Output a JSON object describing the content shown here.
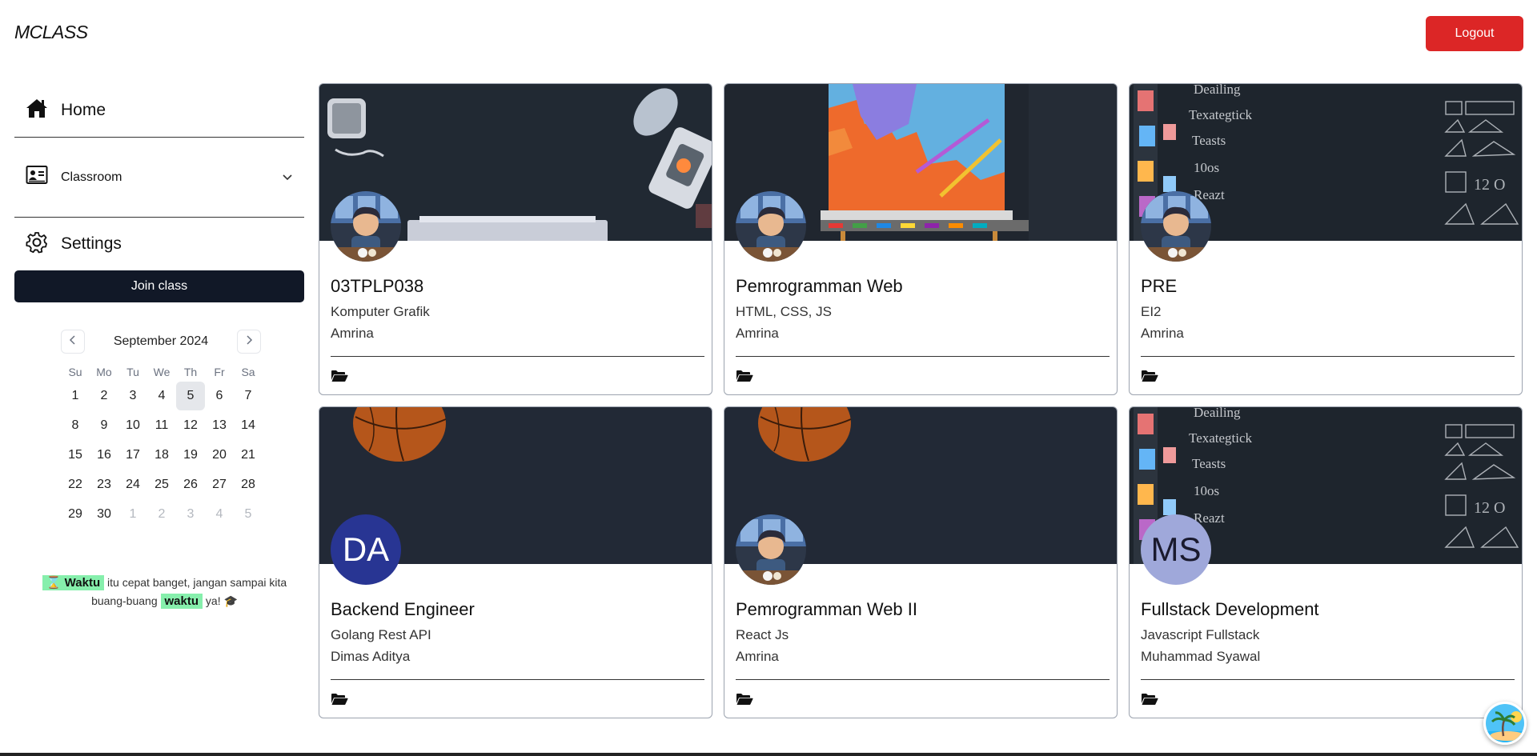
{
  "header": {
    "brand": "MCLASS",
    "logout_label": "Logout"
  },
  "sidebar": {
    "home_label": "Home",
    "classroom_label": "Classroom",
    "settings_label": "Settings",
    "join_label": "Join class"
  },
  "calendar": {
    "month_label": "September 2024",
    "weekdays": [
      "Su",
      "Mo",
      "Tu",
      "We",
      "Th",
      "Fr",
      "Sa"
    ],
    "weeks": [
      [
        "1",
        "2",
        "3",
        "4",
        "5",
        "6",
        "7"
      ],
      [
        "8",
        "9",
        "10",
        "11",
        "12",
        "13",
        "14"
      ],
      [
        "15",
        "16",
        "17",
        "18",
        "19",
        "20",
        "21"
      ],
      [
        "22",
        "23",
        "24",
        "25",
        "26",
        "27",
        "28"
      ],
      [
        "29",
        "30",
        "1",
        "2",
        "3",
        "4",
        "5"
      ]
    ],
    "today": "5"
  },
  "quote": {
    "word1": "⌛ Waktu",
    "text1": " itu cepat banget, jangan sampai kita buang-buang ",
    "word2": "waktu",
    "text2": " ya! 🎓"
  },
  "classes": [
    {
      "title": "03TPLP038",
      "subject": "Komputer Grafik",
      "teacher": "Amrina",
      "avatar_type": "photo",
      "banner": "desk"
    },
    {
      "title": "Pemrogramman Web",
      "subject": "HTML, CSS, JS",
      "teacher": "Amrina",
      "avatar_type": "photo",
      "banner": "easel"
    },
    {
      "title": "PRE",
      "subject": "EI2",
      "teacher": "Amrina",
      "avatar_type": "photo",
      "banner": "chalk"
    },
    {
      "title": "Backend Engineer",
      "subject": "Golang Rest API",
      "teacher": "Dimas Aditya",
      "avatar_type": "initials",
      "initials": "DA",
      "avatar_color": "#283593",
      "initials_color": "#ffffff",
      "banner": "ball"
    },
    {
      "title": "Pemrogramman Web II",
      "subject": "React Js",
      "teacher": "Amrina",
      "avatar_type": "photo",
      "banner": "ball"
    },
    {
      "title": "Fullstack Development",
      "subject": "Javascript Fullstack",
      "teacher": "Muhammad Syawal",
      "avatar_type": "initials",
      "initials": "MS",
      "avatar_color": "#9fa8da",
      "initials_color": "#1a1a2e",
      "banner": "chalk"
    }
  ],
  "colors": {
    "logout": "#dc2626",
    "join": "#111827",
    "highlight": "#86efac",
    "banner_bg": "#1f2630"
  },
  "icons": {
    "home": "home-icon",
    "classroom": "classroom-icon",
    "settings": "gear-icon",
    "folder": "folder-open-icon"
  }
}
